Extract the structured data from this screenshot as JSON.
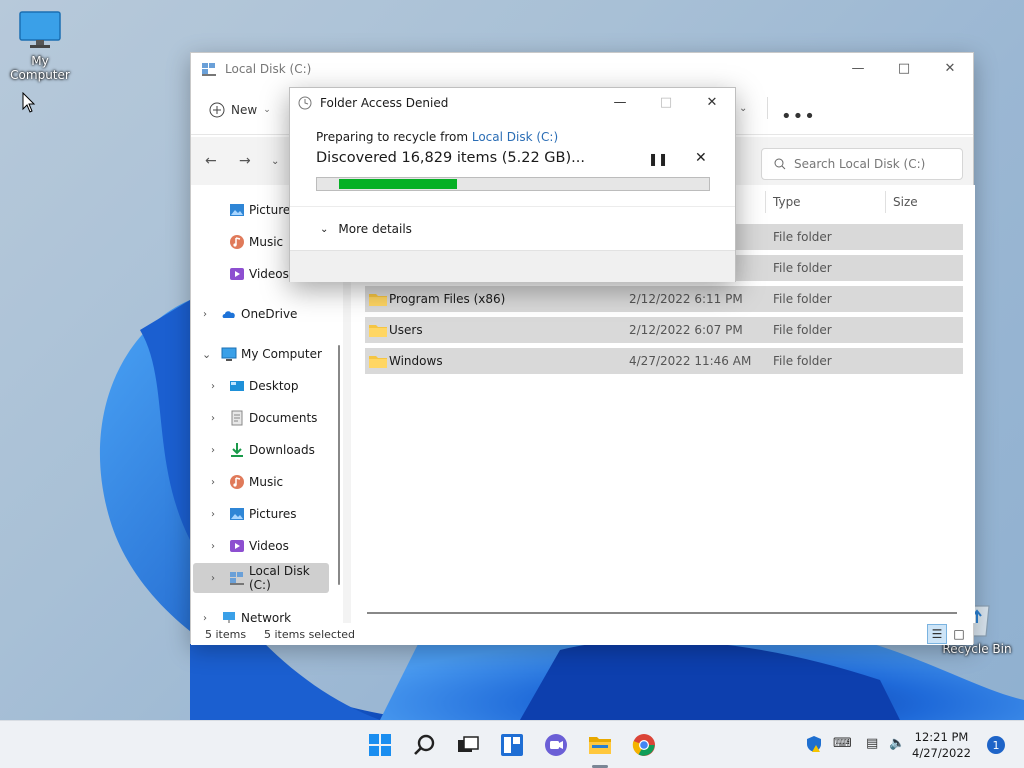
{
  "desktop": {
    "icons": [
      {
        "label": "My Computer"
      },
      {
        "label": "Recycle Bin"
      }
    ]
  },
  "explorer": {
    "title": "Local Disk (C:)",
    "toolbar": {
      "new_label": "New"
    },
    "search": {
      "placeholder": "Search Local Disk (C:)"
    },
    "sidebar": {
      "items": [
        {
          "label": "Pictures",
          "icon": "pictures-icon"
        },
        {
          "label": "Music",
          "icon": "music-icon"
        },
        {
          "label": "Videos",
          "icon": "videos-icon"
        },
        {
          "label": "OneDrive",
          "icon": "onedrive-icon"
        },
        {
          "label": "My Computer",
          "icon": "computer-icon"
        },
        {
          "label": "Desktop",
          "icon": "desktop-icon"
        },
        {
          "label": "Documents",
          "icon": "documents-icon"
        },
        {
          "label": "Downloads",
          "icon": "downloads-icon"
        },
        {
          "label": "Music",
          "icon": "music-icon"
        },
        {
          "label": "Pictures",
          "icon": "pictures-icon"
        },
        {
          "label": "Videos",
          "icon": "videos-icon"
        },
        {
          "label": "Local Disk (C:)",
          "icon": "local-disk-icon"
        },
        {
          "label": "Network",
          "icon": "network-icon"
        }
      ]
    },
    "columns": {
      "type": "Type",
      "size": "Size"
    },
    "rows": [
      {
        "name": "",
        "date": "",
        "type": "File folder"
      },
      {
        "name": "",
        "date": "",
        "type": "File folder"
      },
      {
        "name": "Program Files (x86)",
        "date": "2/12/2022 6:11 PM",
        "type": "File folder"
      },
      {
        "name": "Users",
        "date": "2/12/2022 6:07 PM",
        "type": "File folder"
      },
      {
        "name": "Windows",
        "date": "4/27/2022 11:46 AM",
        "type": "File folder"
      }
    ],
    "status": {
      "count": "5 items",
      "selected": "5 items selected"
    }
  },
  "dialog": {
    "title": "Folder Access Denied",
    "line1_prefix": "Preparing to recycle from ",
    "line1_link": "Local Disk (C:)",
    "line2": "Discovered 16,829 items (5.22 GB)...",
    "progress_fraction": 0.32,
    "more_details": "More details"
  },
  "taskbar": {
    "time": "12:21 PM",
    "date": "4/27/2022",
    "notifications": "1"
  },
  "colors": {
    "accent": "#0067c0",
    "progress": "#06b025"
  }
}
